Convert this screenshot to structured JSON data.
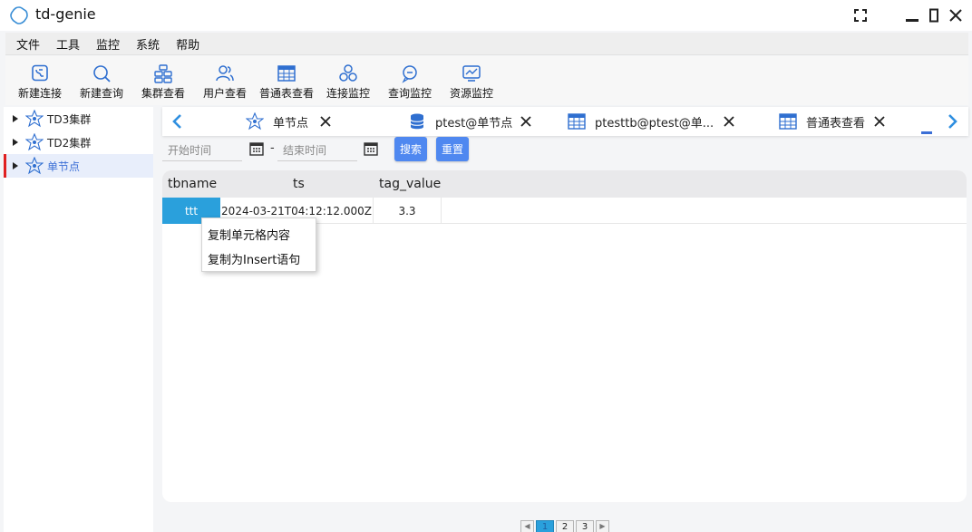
{
  "app": {
    "title": "td-genie"
  },
  "menu": [
    "文件",
    "工具",
    "监控",
    "系统",
    "帮助"
  ],
  "toolbar": [
    {
      "label": "新建连接",
      "icon": "new-connection-icon"
    },
    {
      "label": "新建查询",
      "icon": "new-query-icon"
    },
    {
      "label": "集群查看",
      "icon": "cluster-view-icon"
    },
    {
      "label": "用户查看",
      "icon": "user-view-icon"
    },
    {
      "label": "普通表查看",
      "icon": "table-view-icon"
    },
    {
      "label": "连接监控",
      "icon": "connection-monitor-icon"
    },
    {
      "label": "查询监控",
      "icon": "query-monitor-icon"
    },
    {
      "label": "资源监控",
      "icon": "resource-monitor-icon"
    }
  ],
  "tree": [
    {
      "label": "TD3集群",
      "selected": false
    },
    {
      "label": "TD2集群",
      "selected": false
    },
    {
      "label": "单节点",
      "selected": true
    }
  ],
  "tabs": [
    {
      "label": "单节点",
      "icon": "node-icon"
    },
    {
      "label": "ptest@单节点",
      "icon": "database-icon"
    },
    {
      "label": "ptesttb@ptest@单...",
      "icon": "table-icon"
    },
    {
      "label": "普通表查看",
      "icon": "table-icon"
    }
  ],
  "filter": {
    "start_placeholder": "开始时间",
    "end_placeholder": "结束时间",
    "separator": "-",
    "search_label": "搜索",
    "reset_label": "重置"
  },
  "table": {
    "columns": [
      "tbname",
      "ts",
      "tag_value"
    ],
    "rows": [
      {
        "tbname": "ttt",
        "ts": "2024-03-21T04:12:12.000Z",
        "tag_value": "3.3"
      }
    ]
  },
  "context_menu": [
    "复制单元格内容",
    "复制为Insert语句"
  ],
  "pagination": {
    "pages": [
      "1",
      "2",
      "3"
    ],
    "current": "1"
  },
  "colors": {
    "accent": "#4f88f0",
    "selected_cell": "#2aa0dc",
    "tree_selected_marker": "#e02020"
  }
}
